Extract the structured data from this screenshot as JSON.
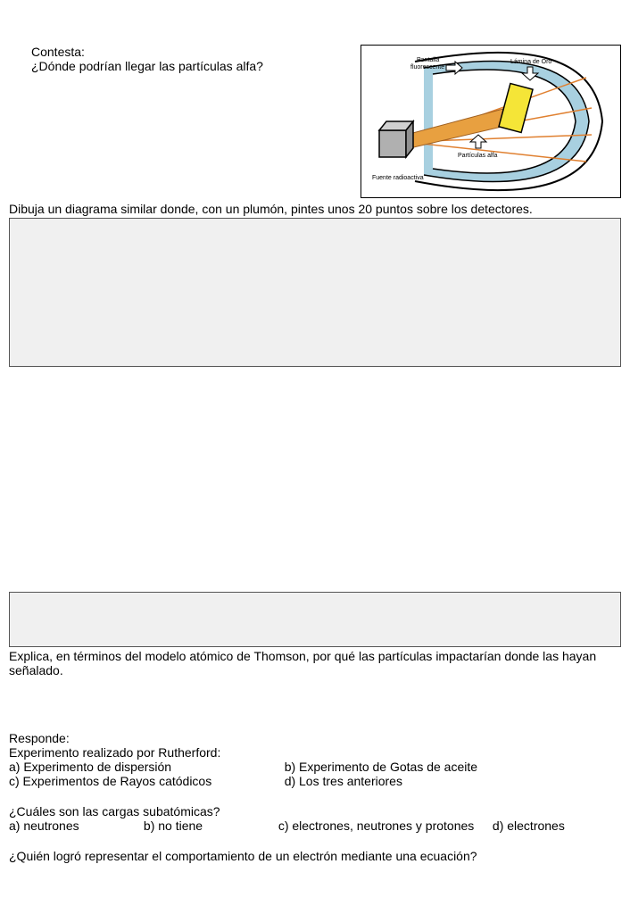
{
  "section1": {
    "title": "Contesta:",
    "question": "¿Dónde podrían llegar las partículas alfa?"
  },
  "diagram": {
    "label_pantalla_a": "Pantalla",
    "label_pantalla_b": "fluorescente",
    "label_lamina": "Lámina de Oro",
    "label_particulas": "Partículas alfa",
    "label_fuente": "Fuente radioactiva"
  },
  "instr1": "Dibuja un diagrama similar donde, con un plumón, pintes unos 20 puntos sobre los detectores.",
  "explain": "Explica, en términos del modelo atómico de Thomson, por qué las partículas impactarían donde las hayan señalado.",
  "respond": {
    "title": "Responde:",
    "q1": {
      "text": "Experimento realizado por Rutherford:",
      "a": "a) Experimento de dispersión",
      "b": "b) Experimento de Gotas de aceite",
      "c": "c) Experimentos de Rayos catódicos",
      "d": "d) Los tres anteriores"
    },
    "q2": {
      "text": "¿Cuáles son las cargas subatómicas?",
      "a": "a) neutrones",
      "b": "b) no tiene",
      "c": "c) electrones, neutrones y protones",
      "d": "d) electrones"
    },
    "q3": {
      "text": "¿Quién logró representar el comportamiento de un electrón mediante una ecuación?"
    }
  }
}
